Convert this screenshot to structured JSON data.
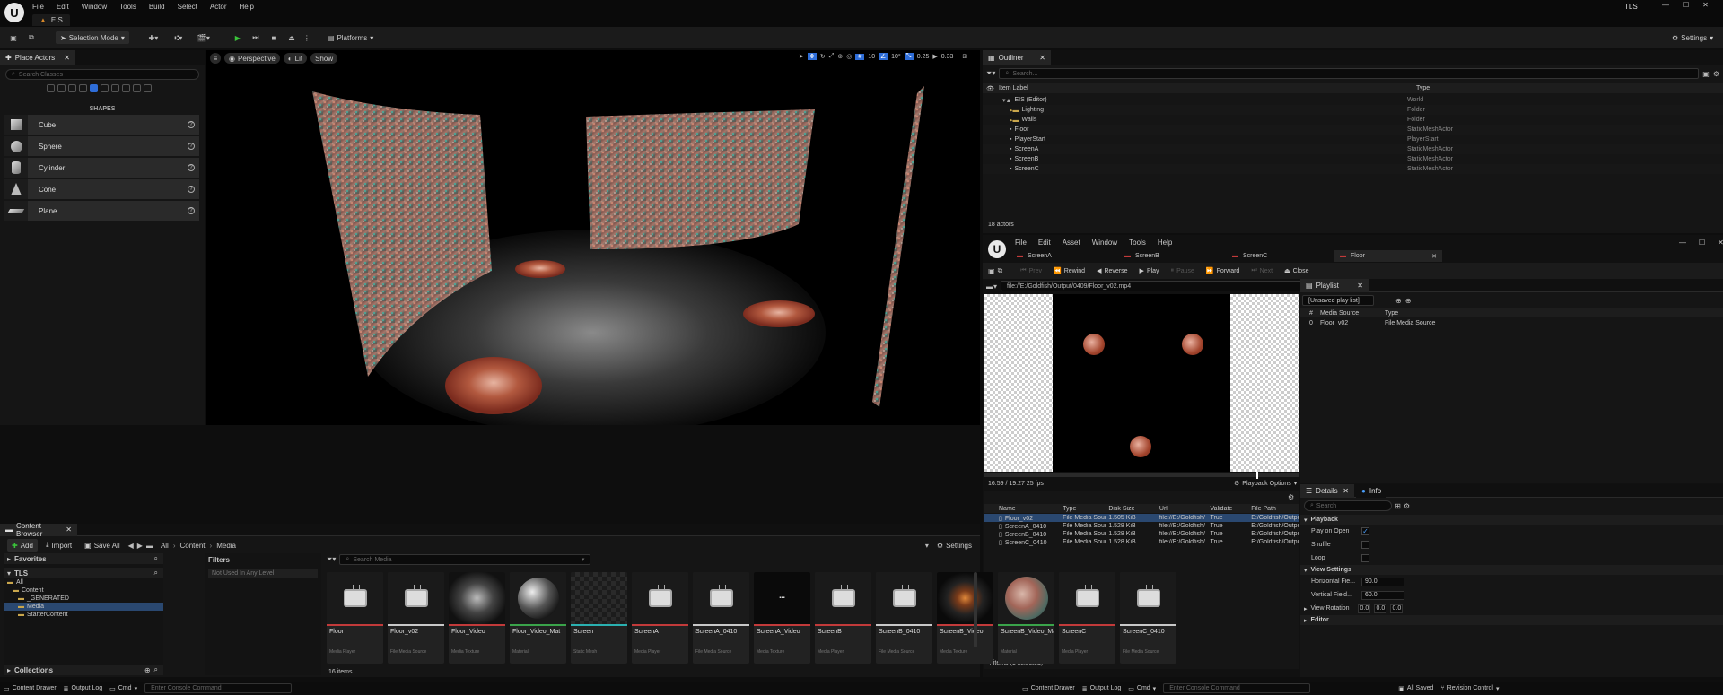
{
  "titlebar": {
    "menus": [
      "File",
      "Edit",
      "Window",
      "Tools",
      "Build",
      "Select",
      "Actor",
      "Help"
    ],
    "project": "TLS",
    "level_tab": "EIS"
  },
  "toolbar": {
    "selection_mode": "Selection Mode",
    "platforms": "Platforms",
    "settings": "Settings"
  },
  "place_actors": {
    "title": "Place Actors",
    "search_placeholder": "Search Classes",
    "section": "SHAPES",
    "items": [
      {
        "label": "Cube"
      },
      {
        "label": "Sphere"
      },
      {
        "label": "Cylinder"
      },
      {
        "label": "Cone"
      },
      {
        "label": "Plane"
      }
    ]
  },
  "viewport": {
    "perspective": "Perspective",
    "lit": "Lit",
    "show": "Show",
    "grid": "10",
    "angle": "10°",
    "scale": "0.25",
    "camera": "0.33"
  },
  "outliner": {
    "title": "Outliner",
    "search_placeholder": "Search...",
    "col_label": "Item Label",
    "col_type": "Type",
    "rows": [
      {
        "label": "EIS (Editor)",
        "type": "World",
        "indent": 1
      },
      {
        "label": "Lighting",
        "type": "Folder",
        "indent": 2
      },
      {
        "label": "Walls",
        "type": "Folder",
        "indent": 2
      },
      {
        "label": "Floor",
        "type": "StaticMeshActor",
        "indent": 2
      },
      {
        "label": "PlayerStart",
        "type": "PlayerStart",
        "indent": 2
      },
      {
        "label": "ScreenA",
        "type": "StaticMeshActor",
        "indent": 2
      },
      {
        "label": "ScreenB",
        "type": "StaticMeshActor",
        "indent": 2
      },
      {
        "label": "ScreenC",
        "type": "StaticMeshActor",
        "indent": 2
      }
    ],
    "count": "18 actors"
  },
  "media_editor": {
    "menus": [
      "File",
      "Edit",
      "Asset",
      "Window",
      "Tools",
      "Help"
    ],
    "tabs": [
      "ScreenA",
      "ScreenB",
      "ScreenC",
      "Floor"
    ],
    "transport": [
      "Prev",
      "Rewind",
      "Reverse",
      "Play",
      "Pause",
      "Forward",
      "Next",
      "Close"
    ],
    "url": "file://E:/Goldfish/Output/0409/Floor_v02.mp4",
    "time": "16:59 / 19:27  25 fps",
    "playback_options": "Playback Options",
    "playlist": {
      "title": "Playlist",
      "name": "[Unsaved play list]",
      "cols": [
        "#",
        "Media Source",
        "Type"
      ],
      "rows": [
        {
          "num": "0",
          "source": "Floor_v02",
          "type": "File Media Source"
        }
      ]
    },
    "table": {
      "cols": [
        "Name",
        "Type",
        "Disk Size",
        "Url",
        "Validate",
        "File Path"
      ],
      "rows": [
        {
          "name": "Floor_v02",
          "type": "File Media Sour",
          "size": "1.505 KiB",
          "url": "file://E:/Goldfish/",
          "validate": "True",
          "path": "E:/Goldfish/Outpu"
        },
        {
          "name": "ScreenA_0410",
          "type": "File Media Sour",
          "size": "1.528 KiB",
          "url": "file://E:/Goldfish/",
          "validate": "True",
          "path": "E:/Goldfish/Outpu"
        },
        {
          "name": "ScreenB_0410",
          "type": "File Media Sour",
          "size": "1.528 KiB",
          "url": "file://E:/Goldfish/",
          "validate": "True",
          "path": "E:/Goldfish/Outpu"
        },
        {
          "name": "ScreenC_0410",
          "type": "File Media Sour",
          "size": "1.528 KiB",
          "url": "file://E:/Goldfish/",
          "validate": "True",
          "path": "E:/Goldfish/Outpu"
        }
      ],
      "footer": "4 items (1 selected)"
    },
    "details": {
      "tab_details": "Details",
      "tab_info": "Info",
      "search_placeholder": "Search",
      "playback": "Playback",
      "play_on_open": "Play on Open",
      "shuffle": "Shuffle",
      "loop": "Loop",
      "view_settings": "View Settings",
      "horizontal_label": "Horizontal Fie...",
      "horizontal_value": "90.0",
      "vertical_label": "Vertical Field...",
      "vertical_value": "60.0",
      "rotation_label": "View Rotation",
      "rot": [
        "0.0",
        "0.0",
        "0.0"
      ],
      "editor": "Editor"
    }
  },
  "content_browser": {
    "title": "Content Browser",
    "add": "Add",
    "import": "Import",
    "save_all": "Save All",
    "path": [
      "All",
      "Content",
      "Media"
    ],
    "settings": "Settings",
    "favorites": "Favorites",
    "project": "TLS",
    "tree": [
      "All",
      "Content",
      "_GENERATED",
      "Media",
      "StarterContent"
    ],
    "filters": "Filters",
    "filter_item": "Not Used In Any Level",
    "search_placeholder": "Search Media",
    "count": "16 items",
    "collections": "Collections",
    "assets": [
      {
        "name": "Floor",
        "kind": "Media Player",
        "bar": "#c23a3a",
        "thumb": "tv"
      },
      {
        "name": "Floor_v02",
        "kind": "File Media Source",
        "bar": "#c8c8c8",
        "thumb": "tv"
      },
      {
        "name": "Floor_Video",
        "kind": "Media Texture",
        "bar": "#c23a3a",
        "thumb": "smoke"
      },
      {
        "name": "Floor_Video_Mat",
        "kind": "Material",
        "bar": "#3aa34a",
        "thumb": "sphere"
      },
      {
        "name": "Screen",
        "kind": "Static Mesh",
        "bar": "#2ab0b0",
        "thumb": "checker"
      },
      {
        "name": "ScreenA",
        "kind": "Media Player",
        "bar": "#c23a3a",
        "thumb": "tv"
      },
      {
        "name": "ScreenA_0410",
        "kind": "File Media Source",
        "bar": "#c8c8c8",
        "thumb": "tv"
      },
      {
        "name": "ScreenA_Video",
        "kind": "Media Texture",
        "bar": "#c23a3a",
        "thumb": "text"
      },
      {
        "name": "ScreenB",
        "kind": "Media Player",
        "bar": "#c23a3a",
        "thumb": "tv"
      },
      {
        "name": "ScreenB_0410",
        "kind": "File Media Source",
        "bar": "#c8c8c8",
        "thumb": "tv"
      },
      {
        "name": "ScreenB_Video",
        "kind": "Media Texture",
        "bar": "#c23a3a",
        "thumb": "fish"
      },
      {
        "name": "ScreenB_Video_Mat",
        "kind": "Material",
        "bar": "#3aa34a",
        "thumb": "fishsphere"
      },
      {
        "name": "ScreenC",
        "kind": "Media Player",
        "bar": "#c23a3a",
        "thumb": "tv"
      },
      {
        "name": "ScreenC_0410",
        "kind": "File Media Source",
        "bar": "#c8c8c8",
        "thumb": "tv"
      }
    ]
  },
  "statusbar": {
    "drawer": "Content Drawer",
    "output_log": "Output Log",
    "cmd": "Cmd",
    "console_placeholder": "Enter Console Command",
    "all_saved": "All Saved",
    "revision": "Revision Control"
  }
}
